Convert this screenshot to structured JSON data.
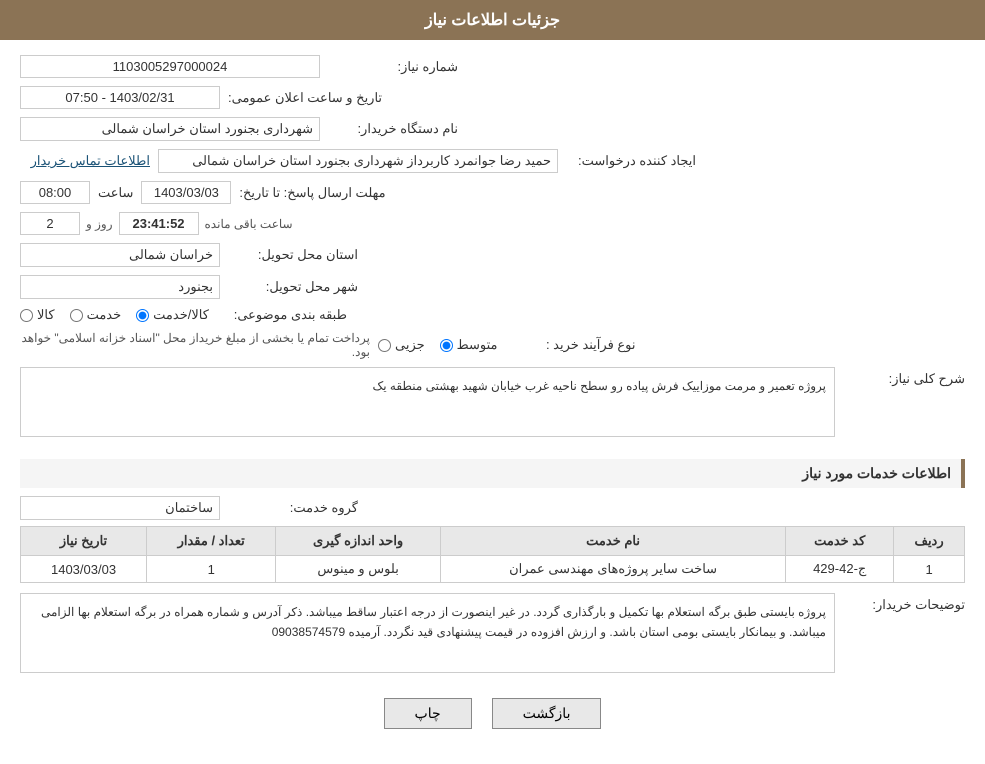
{
  "page": {
    "title": "جزئیات اطلاعات نیاز"
  },
  "fields": {
    "shomara_niaz_label": "شماره نیاز:",
    "shomara_niaz_value": "1103005297000024",
    "name_dastgah_label": "نام دستگاه خریدار:",
    "name_dastgah_value": "شهرداری بجنورد استان خراسان شمالی",
    "ijad_label": "ایجاد کننده درخواست:",
    "ijad_value": "حمید رضا جوانمرد کاربرداز شهرداری بجنورد استان خراسان شمالی",
    "ettelaat_tamas_label": "اطلاعات تماس خریدار",
    "mohlat_label": "مهلت ارسال پاسخ: تا تاریخ:",
    "mohlat_date": "1403/03/03",
    "mohlat_saat_label": "ساعت",
    "mohlat_saat": "08:00",
    "mohlat_rooz_label": "روز و",
    "mohlat_rooz": "2",
    "mohlat_countdown": "23:41:52",
    "mohlat_baqi_label": "ساعت باقی مانده",
    "ostan_tahvil_label": "استان محل تحویل:",
    "ostan_tahvil_value": "خراسان شمالی",
    "shahr_tahvil_label": "شهر محل تحویل:",
    "shahr_tahvil_value": "بجنورد",
    "tabaqe_label": "طبقه بندی موضوعی:",
    "tabaqe_kala": "کالا",
    "tabaqe_khadamat": "خدمت",
    "tabaqe_kala_khadamat": "کالا/خدمت",
    "tabaqe_selected": "kala_khadamat",
    "nou_farayand_label": "نوع فرآیند خرید :",
    "nou_jozii": "جزیی",
    "nou_motevaset": "متوسط",
    "nou_description": "پرداخت تمام یا بخشی از مبلغ خریداز محل \"اسناد خزانه اسلامی\" خواهد بود.",
    "nou_selected": "motevaset",
    "sharh_label": "شرح کلی نیاز:",
    "sharh_value": "پروژه تعمیر و مرمت موزاییک فرش پیاده رو سطح ناحیه غرب خیابان شهید بهشتی منطقه یک",
    "service_title": "اطلاعات خدمات مورد نیاز",
    "goroh_label": "گروه خدمت:",
    "goroh_value": "ساختمان",
    "table": {
      "headers": [
        "ردیف",
        "کد خدمت",
        "نام خدمت",
        "واحد اندازه گیری",
        "تعداد / مقدار",
        "تاریخ نیاز"
      ],
      "rows": [
        {
          "radif": "1",
          "kod": "ج-42-429",
          "name": "ساخت سایر پروژه‌های مهندسی عمران",
          "unit": "بلوس و مینوس",
          "count": "1",
          "date": "1403/03/03"
        }
      ]
    },
    "tosiyat_label": "توضیحات خریدار:",
    "tosiyat_value": "پروژه بایستی طبق برگه استعلام بها  تکمیل و بارگذاری گردد. در غیر اینصورت از درجه اعتبار ساقط میباشد. ذکر آدرس و شماره همراه در برگه استعلام بها الزامی میباشد. و بیمانکار بایستی بومی استان باشد.  و ارزش افزوده در قیمت پیشنهادی قید نگردد. آرمیده 09038574579",
    "buttons": {
      "back_label": "بازگشت",
      "print_label": "چاپ"
    },
    "announce_label": "تاریخ و ساعت اعلان عمومی:",
    "announce_value": "1403/02/31 - 07:50"
  }
}
